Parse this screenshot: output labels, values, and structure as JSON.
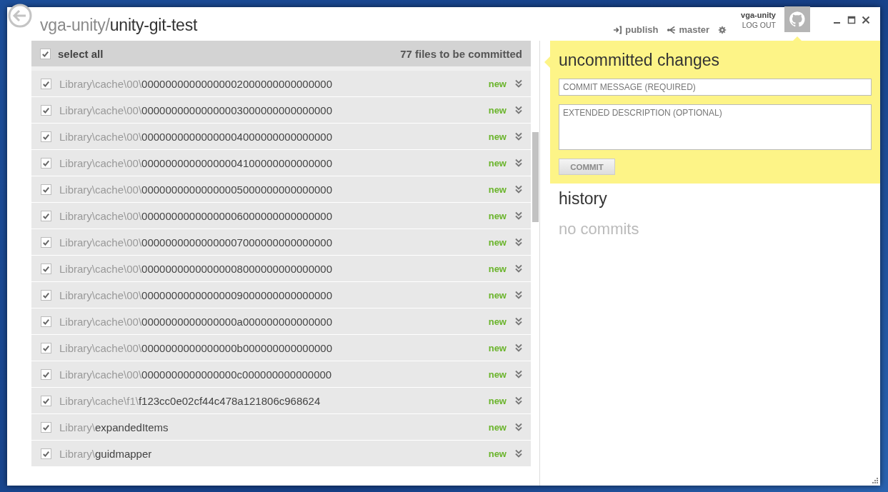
{
  "repository": {
    "owner": "vga-unity/",
    "name": "unity-git-test"
  },
  "toolbar": [
    {
      "kind": "publish",
      "label": "publish"
    },
    {
      "kind": "branch",
      "label": "master"
    },
    {
      "kind": "settings"
    }
  ],
  "account": {
    "username": "vga-unity",
    "logout": "LOG OUT"
  },
  "changes": {
    "select_all": {
      "label": "select all",
      "checked": true
    },
    "count": "77 files to be committed",
    "files": [
      {
        "dir": "Library\\cache\\00\\",
        "name": "00000000000000002000000000000000",
        "status": "new",
        "checked": true
      },
      {
        "dir": "Library\\cache\\00\\",
        "name": "00000000000000003000000000000000",
        "status": "new",
        "checked": true
      },
      {
        "dir": "Library\\cache\\00\\",
        "name": "00000000000000004000000000000000",
        "status": "new",
        "checked": true
      },
      {
        "dir": "Library\\cache\\00\\",
        "name": "00000000000000004100000000000000",
        "status": "new",
        "checked": true
      },
      {
        "dir": "Library\\cache\\00\\",
        "name": "00000000000000005000000000000000",
        "status": "new",
        "checked": true
      },
      {
        "dir": "Library\\cache\\00\\",
        "name": "00000000000000006000000000000000",
        "status": "new",
        "checked": true
      },
      {
        "dir": "Library\\cache\\00\\",
        "name": "00000000000000007000000000000000",
        "status": "new",
        "checked": true
      },
      {
        "dir": "Library\\cache\\00\\",
        "name": "00000000000000008000000000000000",
        "status": "new",
        "checked": true
      },
      {
        "dir": "Library\\cache\\00\\",
        "name": "00000000000000009000000000000000",
        "status": "new",
        "checked": true
      },
      {
        "dir": "Library\\cache\\00\\",
        "name": "0000000000000000a000000000000000",
        "status": "new",
        "checked": true
      },
      {
        "dir": "Library\\cache\\00\\",
        "name": "0000000000000000b000000000000000",
        "status": "new",
        "checked": true
      },
      {
        "dir": "Library\\cache\\00\\",
        "name": "0000000000000000c000000000000000",
        "status": "new",
        "checked": true
      },
      {
        "dir": "Library\\cache\\f1\\",
        "name": "f123cc0e02cf44c478a121806c968624",
        "status": "new",
        "checked": true
      },
      {
        "dir": "Library\\",
        "name": "expandedItems",
        "status": "new",
        "checked": true
      },
      {
        "dir": "Library\\",
        "name": "guidmapper",
        "status": "new",
        "checked": true
      }
    ]
  },
  "commit": {
    "title": "uncommitted changes",
    "message": {
      "placeholder": "COMMIT MESSAGE (REQUIRED)"
    },
    "description": {
      "placeholder": "EXTENDED DESCRIPTION (OPTIONAL)"
    },
    "button": {
      "label": "COMMIT",
      "disabled": true
    }
  },
  "history": {
    "title": "history",
    "empty": "no commits"
  }
}
